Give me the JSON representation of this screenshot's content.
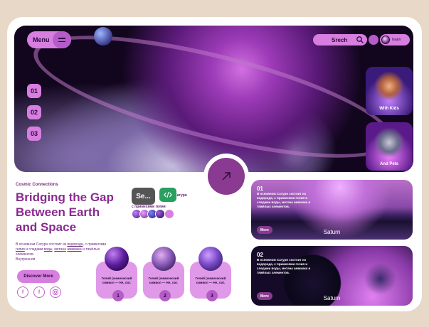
{
  "header": {
    "menu_label": "Menu",
    "search_label": "Srech",
    "user_name": "Isaan"
  },
  "hero": {
    "nav_numbers": [
      "01",
      "02",
      "03"
    ],
    "thumbnails": [
      {
        "label": "With Kids"
      },
      {
        "label": "And Pets"
      }
    ]
  },
  "intro": {
    "eyebrow": "Cosmic Connections",
    "headline_lines": [
      "Bridging the Gap",
      "Between Earth",
      "and Space"
    ],
    "body": {
      "t1": "В основном Сатурн состоит из ",
      "l1": "водорода",
      "t2": ", с примесями ",
      "l2": "гелия",
      "t3": " и следами ",
      "l3": "воды",
      "t4": ", ",
      "l4": "метана",
      "t5": " ",
      "l5": "аммиака",
      "t6": " и тяжёлых элементов.",
      "t7": "Внутренняя"
    },
    "discover_label": "Discover More",
    "social_icons": [
      "facebook-icon",
      "facebook-icon",
      "instagram-icon"
    ]
  },
  "tags": {
    "se_label": "Se...",
    "text_line1": "Сатурн",
    "text_line2": "с примесями гелия"
  },
  "planets": [
    {
      "caption": "Гелий (химический символ — He, лат.",
      "num": "1"
    },
    {
      "caption": "Гелий (химический символ — He, лат.",
      "num": "2"
    },
    {
      "caption": "Гелий (химический символ — He, лат.",
      "num": "3"
    }
  ],
  "saturn_cards": [
    {
      "num": "01",
      "text": "В основном Сатурн состоит из водорода, с примесями гелия и следами воды, метана аммиака и тяжёлых элементов.",
      "more": "More",
      "title": "Saturn"
    },
    {
      "num": "02",
      "text": "В основном Сатурн состоит из водорода, с примесями гелия и следами воды, метана аммиака и тяжёлых элементов.",
      "more": "More",
      "title": "Saturn"
    }
  ],
  "colors": {
    "accent": "#d77ee0",
    "accent_dark": "#8a3a90",
    "headline": "#8a2a90",
    "page_bg": "#e8d8c8"
  }
}
